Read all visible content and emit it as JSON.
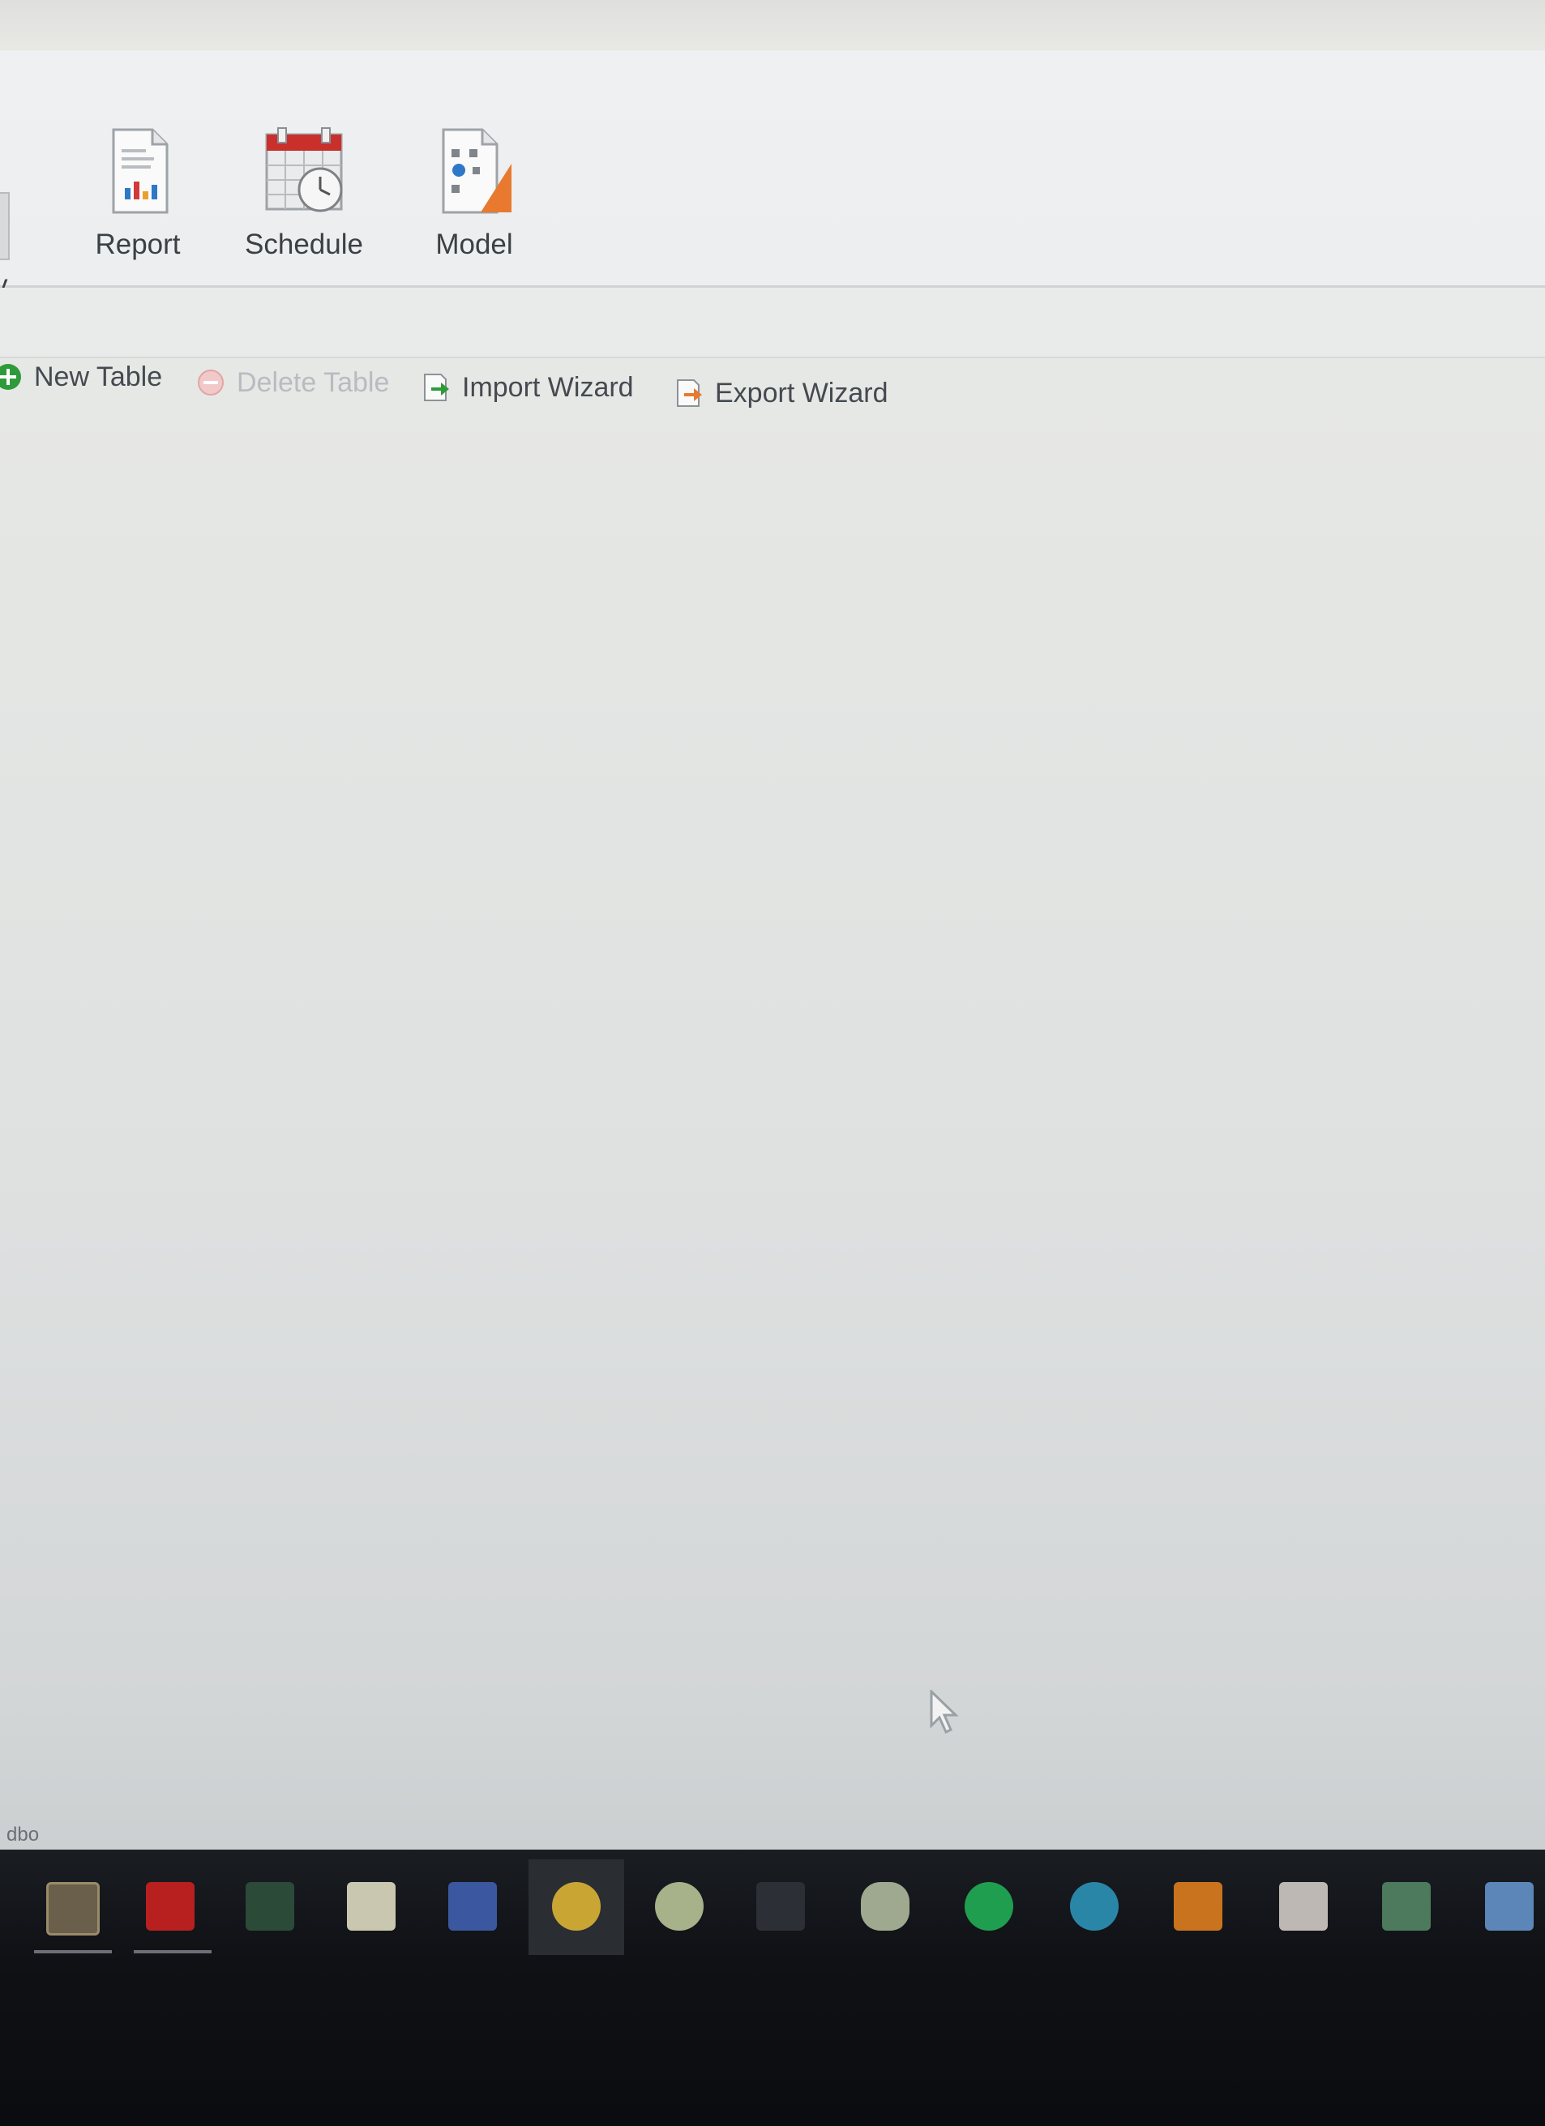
{
  "ribbon": {
    "partial_label": "y",
    "buttons": [
      {
        "label": "Report"
      },
      {
        "label": "Schedule"
      },
      {
        "label": "Model"
      }
    ]
  },
  "toolbar": {
    "new_table": "New Table",
    "delete_table": "Delete Table",
    "import_wizard": "Import Wizard",
    "export_wizard": "Export Wizard"
  },
  "status": {
    "schema": "dbo"
  },
  "colors": {
    "accent_green": "#2e9b3a",
    "accent_red": "#d23a3a",
    "accent_orange": "#e8792f",
    "accent_blue": "#2f78c8"
  },
  "taskbar": {
    "icons": [
      "window-icon",
      "filezilla-icon",
      "network-tool-icon",
      "spreadsheet-icon",
      "remote-desktop-icon",
      "chat-icon",
      "messenger-icon",
      "terminal-icon",
      "cloud-icon",
      "spotify-icon",
      "browser-icon",
      "folder-icon",
      "document-icon",
      "tool-icon",
      "app-icon"
    ]
  }
}
